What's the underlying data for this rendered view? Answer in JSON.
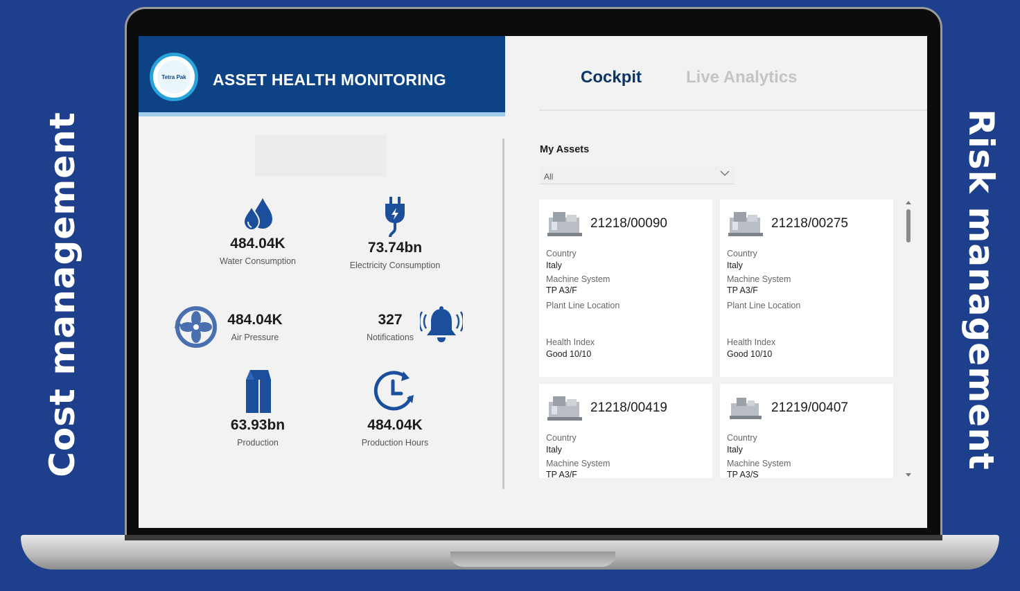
{
  "side_labels": {
    "left": "Cost management",
    "right": "Risk management"
  },
  "header": {
    "title": "ASSET HEALTH MONITORING",
    "logo_text": "Tetra Pak"
  },
  "nav": {
    "tabs": [
      {
        "label": "Cockpit",
        "active": true
      },
      {
        "label": "Live Analytics",
        "active": false
      }
    ]
  },
  "kpis": {
    "water": {
      "value": "484.04K",
      "label": "Water Consumption",
      "icon": "water-drops-icon"
    },
    "electricity": {
      "value": "73.74bn",
      "label": "Electricity Consumption",
      "icon": "electric-plug-icon"
    },
    "air": {
      "value": "484.04K",
      "label": "Air Pressure",
      "icon": "fan-icon"
    },
    "notifications": {
      "value": "327",
      "label": "Notifications",
      "icon": "bell-icon"
    },
    "production": {
      "value": "63.93bn",
      "label": "Production",
      "icon": "carton-icon"
    },
    "production_hours": {
      "value": "484.04K",
      "label": "Production Hours",
      "icon": "clock-icon"
    }
  },
  "assets": {
    "title": "My Assets",
    "filter": {
      "selected": "All"
    },
    "field_labels": {
      "country": "Country",
      "machine_system": "Machine System",
      "plant_line_location": "Plant Line Location",
      "health_index": "Health Index"
    },
    "cards": [
      {
        "id": "21218/00090",
        "country": "Italy",
        "machine_system": "TP A3/F",
        "plant_line_location": "",
        "health_index": "Good 10/10"
      },
      {
        "id": "21218/00275",
        "country": "Italy",
        "machine_system": "TP A3/F",
        "plant_line_location": "",
        "health_index": "Good 10/10"
      },
      {
        "id": "21218/00419",
        "country": "Italy",
        "machine_system": "TP A3/F"
      },
      {
        "id": "21219/00407",
        "country": "Italy",
        "machine_system": "TP A3/S"
      }
    ]
  },
  "colors": {
    "background": "#1d3f8c",
    "header": "#0d4384",
    "accent": "#0d3466",
    "icon_blue": "#1b4f9c",
    "header_stripe": "#9fcbe8"
  }
}
